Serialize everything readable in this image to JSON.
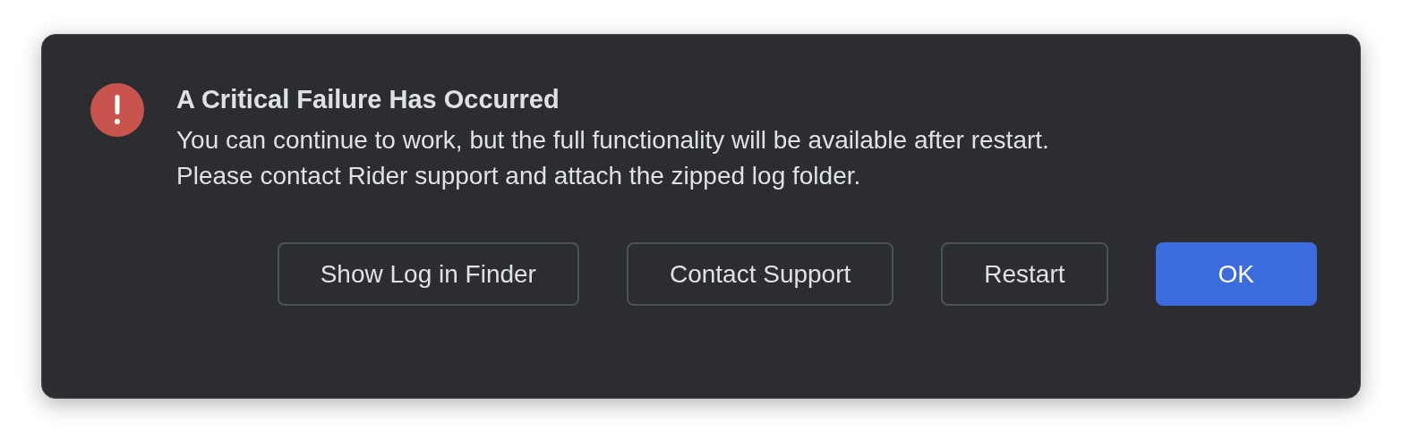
{
  "dialog": {
    "title": "A Critical Failure Has Occurred",
    "message": [
      "You can continue to work, but the full functionality will be available after restart.",
      "Please contact Rider support and attach the zipped log folder."
    ],
    "buttons": [
      {
        "label": "Show Log in Finder",
        "kind": "secondary"
      },
      {
        "label": "Contact Support",
        "kind": "secondary"
      },
      {
        "label": "Restart",
        "kind": "secondary"
      },
      {
        "label": "OK",
        "kind": "primary"
      }
    ]
  }
}
